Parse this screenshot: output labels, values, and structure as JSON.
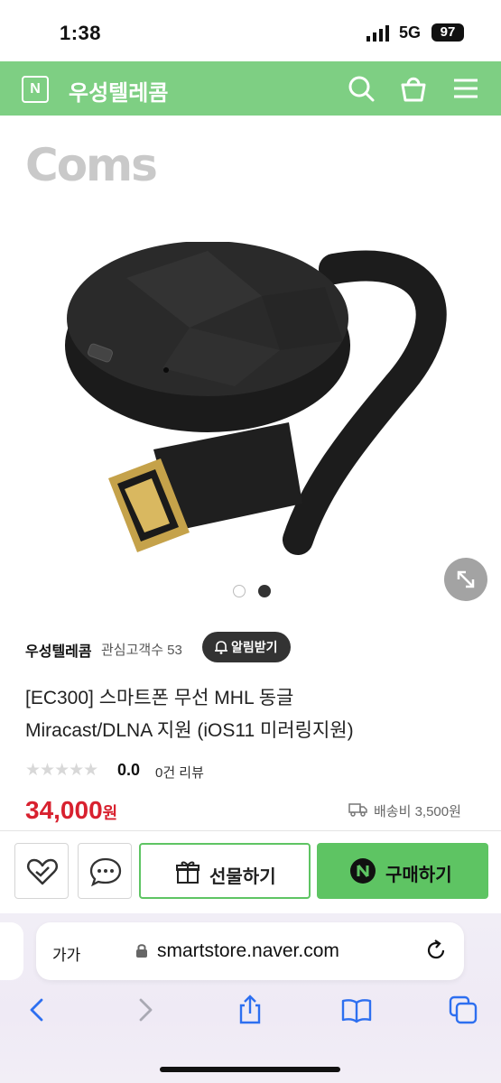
{
  "status_bar": {
    "time": "1:38",
    "network": "5G",
    "battery": "97"
  },
  "header": {
    "store_name": "우성텔레콤",
    "icons": [
      "naver-n-icon",
      "search-icon",
      "shopping-bag-icon",
      "menu-icon"
    ]
  },
  "gallery": {
    "brand_text": "Coms",
    "slides_total": 2,
    "active_slide": 2
  },
  "seller": {
    "name": "우성텔레콤",
    "followers_label": "관심고객수 53",
    "alarm_button": "알림받기"
  },
  "product": {
    "title_line1": "[EC300] 스마트폰 무선 MHL 동글",
    "title_line2": "Miracast/DLNA 지원 (iOS11 미러링지원)",
    "rating": "0.0",
    "reviews": "0건 리뷰",
    "price": "34,000",
    "currency": "원",
    "shipping": "배송비 3,500원"
  },
  "actions": {
    "gift_label": "선물하기",
    "buy_label": "구매하기"
  },
  "browser": {
    "text_size_label": "가가",
    "url": "smartstore.naver.com"
  },
  "colors": {
    "brand_green": "#7ecf83",
    "button_green": "#5ec463",
    "price_red": "#d8212f"
  }
}
